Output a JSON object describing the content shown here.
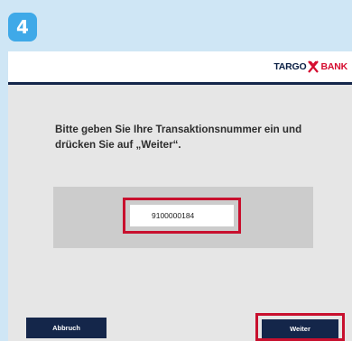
{
  "step": {
    "number": "4"
  },
  "brand": {
    "part1": "TARGO",
    "part2": "BANK",
    "icon": "targo-bank-logo-icon",
    "colors": {
      "navy": "#0a1f44",
      "red": "#d50c2f"
    }
  },
  "instruction": {
    "text": "Bitte geben Sie Ihre Transaktionsnummer ein und drücken Sie auf „Weiter“."
  },
  "tan_field": {
    "value": "9100000184"
  },
  "buttons": {
    "abort_label": "Abbruch",
    "next_label": "Weiter"
  },
  "colors": {
    "background": "#cfe6f5",
    "badge": "#3fa9e8",
    "button": "#14264a",
    "highlight": "#c8102e"
  }
}
